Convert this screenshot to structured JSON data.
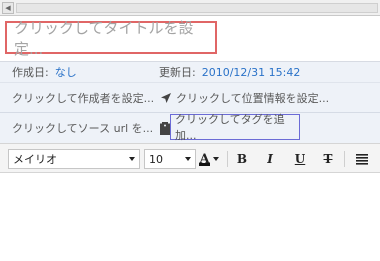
{
  "title_placeholder": "クリックしてタイトルを設定...",
  "meta": {
    "created_label": "作成日:",
    "created_value": "なし",
    "updated_label": "更新日:",
    "updated_value": "2010/12/31 15:42",
    "author": "クリックして作成者を設定...",
    "location": "クリックして位置情報を設定...",
    "source_url": "クリックしてソース url を...",
    "tags": "クリックしてタグを追加..."
  },
  "toolbar": {
    "font_family": "メイリオ",
    "font_size": "10",
    "font_color_label": "A",
    "bold_label": "B",
    "italic_label": "I",
    "underline_label": "U",
    "strike_label": "T"
  },
  "icons": [
    "arrow-left-icon",
    "location-arrow-icon",
    "tag-icon",
    "align-justify-icon",
    "chevron-down-icon"
  ],
  "colors": {
    "title_border": "#e06666",
    "tag_border": "#6b6bd6",
    "link_blue": "#2a72c8",
    "meta_bg": "#eef2f8"
  }
}
